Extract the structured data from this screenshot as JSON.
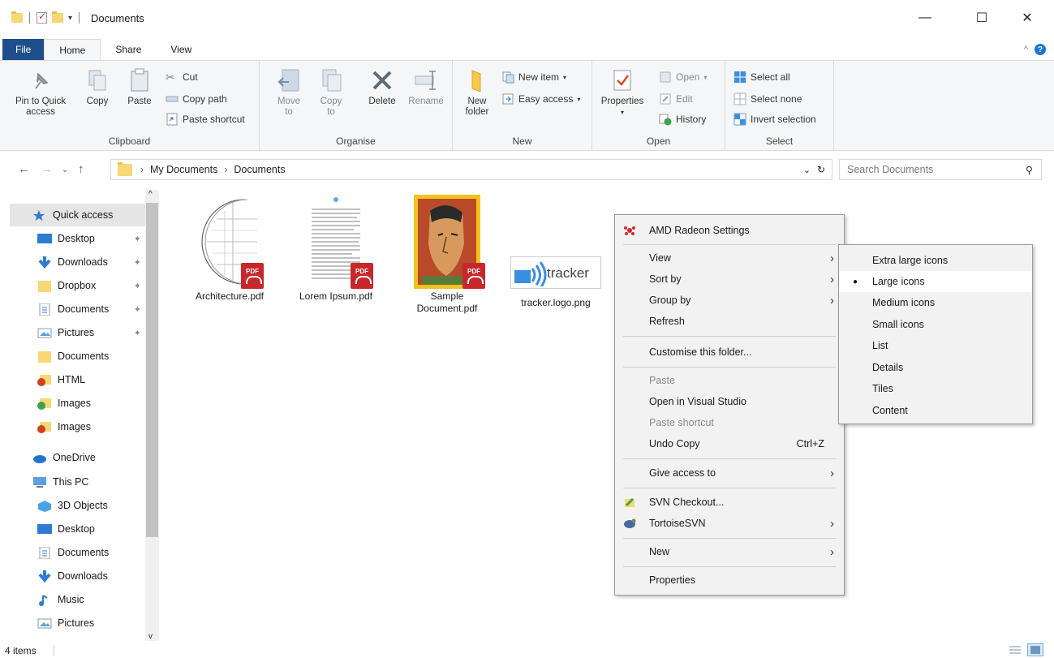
{
  "window": {
    "title": "Documents",
    "minimize_glyph": "—",
    "maximize_glyph": "☐",
    "close_glyph": "✕"
  },
  "ribbon_tabs": [
    "File",
    "Home",
    "Share",
    "View"
  ],
  "ribbon_collapse_glyph": "^",
  "help_glyph": "?",
  "clipboard": {
    "pin": "Pin to Quick access",
    "copy": "Copy",
    "paste": "Paste",
    "cut": "Cut",
    "copy_path": "Copy path",
    "paste_shortcut": "Paste shortcut",
    "label": "Clipboard"
  },
  "organise": {
    "move_to": "Move to",
    "copy_to": "Copy to",
    "delete": "Delete",
    "rename": "Rename",
    "label": "Organise"
  },
  "new_group": {
    "new_folder": "New folder",
    "new_item": "New item",
    "easy_access": "Easy access",
    "label": "New"
  },
  "open_group": {
    "properties": "Properties",
    "open": "Open",
    "edit": "Edit",
    "history": "History",
    "label": "Open"
  },
  "select_group": {
    "select_all": "Select all",
    "select_none": "Select none",
    "invert_selection": "Invert selection",
    "label": "Select"
  },
  "address": {
    "crumbs": [
      "My Documents",
      "Documents"
    ],
    "search_placeholder": "Search Documents"
  },
  "nav_pane": {
    "quick_access": "Quick access",
    "items": [
      {
        "label": "Desktop",
        "pinned": true
      },
      {
        "label": "Downloads",
        "pinned": true
      },
      {
        "label": "Dropbox",
        "pinned": true
      },
      {
        "label": "Documents",
        "pinned": true
      },
      {
        "label": "Pictures",
        "pinned": true
      },
      {
        "label": "Documents",
        "pinned": false
      },
      {
        "label": "HTML",
        "pinned": false
      },
      {
        "label": "Images",
        "pinned": false
      },
      {
        "label": "Images",
        "pinned": false
      }
    ],
    "onedrive": "OneDrive",
    "this_pc": "This PC",
    "pc_items": [
      "3D Objects",
      "Desktop",
      "Documents",
      "Downloads",
      "Music",
      "Pictures"
    ]
  },
  "files": [
    {
      "name": "Architecture.pdf",
      "type": "pdf"
    },
    {
      "name": "Lorem Ipsum.pdf",
      "type": "pdf"
    },
    {
      "name": "Sample Document.pdf",
      "type": "pdf"
    },
    {
      "name": "tracker.logo.png",
      "type": "png"
    }
  ],
  "file_badge": "PDF",
  "tracker_logo_text": "tracker",
  "context_menu": {
    "amd": "AMD Radeon Settings",
    "view": "View",
    "sort_by": "Sort by",
    "group_by": "Group by",
    "refresh": "Refresh",
    "customise": "Customise this folder...",
    "paste": "Paste",
    "open_vs": "Open in Visual Studio",
    "paste_shortcut": "Paste shortcut",
    "undo_copy": "Undo Copy",
    "undo_shortcut": "Ctrl+Z",
    "give_access": "Give access to",
    "svn_checkout": "SVN Checkout...",
    "tortoise": "TortoiseSVN",
    "new": "New",
    "properties": "Properties"
  },
  "view_submenu": {
    "items": [
      "Extra large icons",
      "Large icons",
      "Medium icons",
      "Small icons",
      "List",
      "Details",
      "Tiles",
      "Content"
    ],
    "selected": "Large icons"
  },
  "status": {
    "item_count": "4 items"
  },
  "colors": {
    "file_tab": "#1e4e8c",
    "folder": "#f8d775",
    "pdf_red": "#c8282b",
    "accent_blue": "#1e76d2"
  }
}
